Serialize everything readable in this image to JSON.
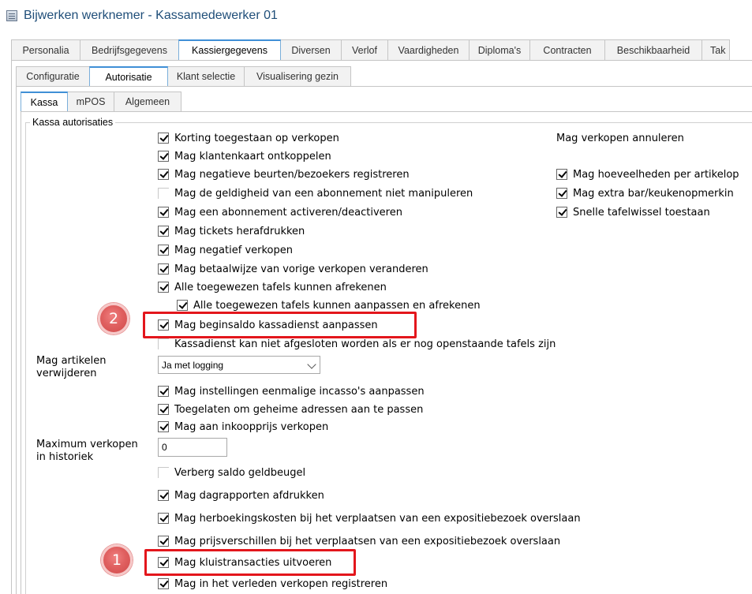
{
  "window": {
    "title": "Bijwerken werknemer - Kassamedewerker 01"
  },
  "main_tabs": [
    "Personalia",
    "Bedrijfsgegevens",
    "Kassiergegevens",
    "Diversen",
    "Verlof",
    "Vaardigheden",
    "Diploma's",
    "Contracten",
    "Beschikbaarheid",
    "Tak"
  ],
  "sub_tabs": [
    "Configuratie",
    "Autorisatie",
    "Klant selectie",
    "Visualisering gezin"
  ],
  "third_tabs": [
    "Kassa",
    "mPOS",
    "Algemeen"
  ],
  "group": {
    "title": "Kassa autorisaties"
  },
  "left_column": [
    {
      "label": "Korting toegestaan op verkopen",
      "checked": true
    },
    {
      "label": "Mag klantenkaart ontkoppelen",
      "checked": true
    },
    {
      "label": "Mag negatieve beurten/bezoekers registreren",
      "checked": true
    },
    {
      "label": "Mag de geldigheid van een abonnement niet manipuleren",
      "checked": false
    },
    {
      "label": "Mag een abonnement activeren/deactiveren",
      "checked": true
    },
    {
      "label": "Mag tickets herafdrukken",
      "checked": true
    },
    {
      "label": "Mag negatief verkopen",
      "checked": true
    },
    {
      "label": "Mag betaalwijze van vorige verkopen veranderen",
      "checked": true
    },
    {
      "label": "Alle toegewezen tafels kunnen afrekenen",
      "checked": true
    },
    {
      "label": "Alle toegewezen tafels kunnen aanpassen en afrekenen",
      "checked": true
    },
    {
      "label": "Mag beginsaldo kassadienst aanpassen",
      "checked": true
    },
    {
      "label": "Kassadienst kan niet afgesloten worden als er nog openstaande tafels zijn",
      "checked": false
    }
  ],
  "right_column": {
    "header": "Mag verkopen annuleren",
    "items": [
      {
        "label": "Mag hoeveelheden per artikelop",
        "checked": true
      },
      {
        "label": "Mag extra bar/keukenopmerkin",
        "checked": true
      },
      {
        "label": "Snelle tafelwissel toestaan",
        "checked": true
      }
    ]
  },
  "delete_articles": {
    "label_line1": "Mag artikelen",
    "label_line2": "verwijderen",
    "selected": "Ja met logging"
  },
  "middle_checks": [
    {
      "label": "Mag instellingen eenmalige incasso's aanpassen",
      "checked": true
    },
    {
      "label": "Toegelaten om geheime adressen aan te passen",
      "checked": true
    },
    {
      "label": "Mag aan inkoopprijs verkopen",
      "checked": true
    }
  ],
  "max_sales": {
    "label_line1": "Maximum verkopen",
    "label_line2": "in historiek",
    "value": "0"
  },
  "bottom_checks": [
    {
      "label": "Verberg saldo geldbeugel",
      "checked": false
    },
    {
      "label": "Mag dagrapporten afdrukken",
      "checked": true
    },
    {
      "label": "Mag herboekingskosten bij het verplaatsen van een expositiebezoek overslaan",
      "checked": true
    },
    {
      "label": "Mag prijsverschillen bij het verplaatsen van een expositiebezoek overslaan",
      "checked": true
    },
    {
      "label": "Mag kluistransacties uitvoeren",
      "checked": true
    },
    {
      "label": "Mag in het verleden verkopen registreren",
      "checked": true
    }
  ],
  "annotations": {
    "badge_1": "1",
    "badge_2": "2",
    "color": "#e3161c"
  }
}
